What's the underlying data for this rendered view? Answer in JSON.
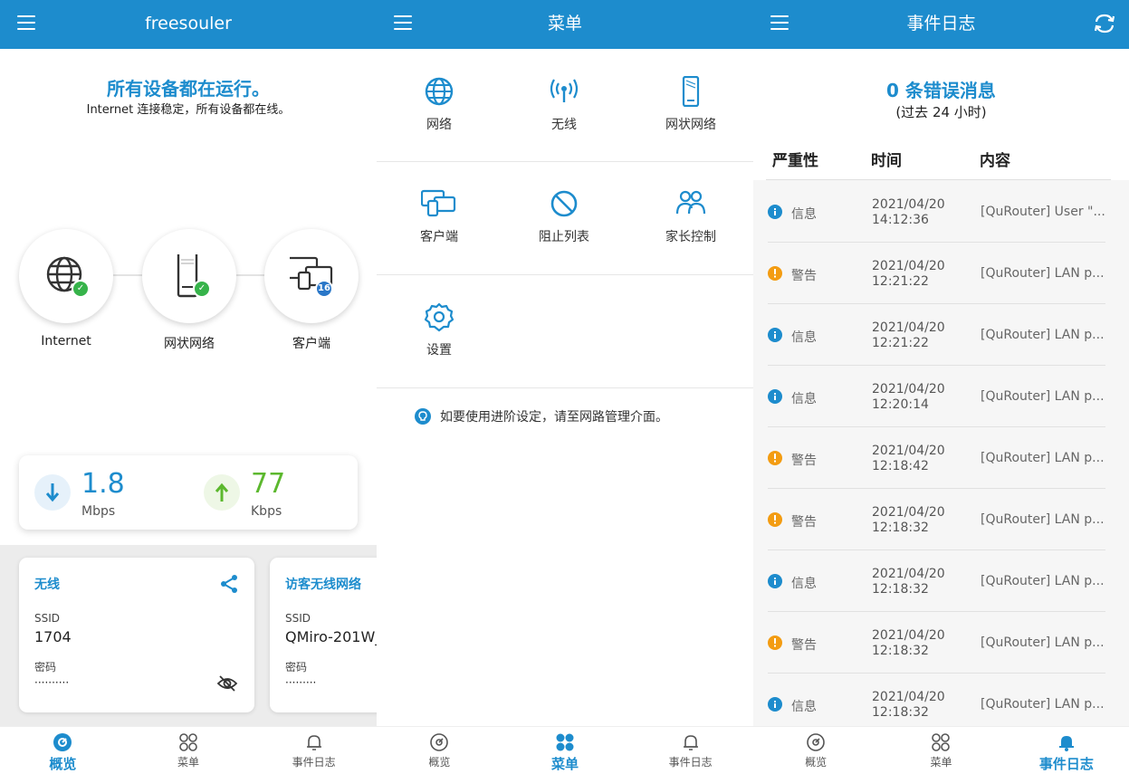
{
  "overview": {
    "app_title": "freesouler",
    "status_title": "所有设备都在运行。",
    "status_sub": "Internet 连接稳定，所有设备都在线。",
    "nodes": [
      {
        "label": "Internet",
        "icon": "globe-icon",
        "status": "ok"
      },
      {
        "label": "网状网络",
        "icon": "router-icon",
        "status": "ok"
      },
      {
        "label": "客户端",
        "icon": "clients-icon",
        "count": "16"
      }
    ],
    "download": {
      "value": "1.8",
      "unit": "Mbps"
    },
    "upload": {
      "value": "77",
      "unit": "Kbps"
    },
    "wireless_card": {
      "title": "无线",
      "ssid_label": "SSID",
      "ssid": "1704",
      "pwd_label": "密码",
      "pwd_mask": "··········"
    },
    "guest_card": {
      "title": "访客无线网络",
      "ssid_label": "SSID",
      "ssid": "QMiro-201W_",
      "pwd_label": "密码",
      "pwd_mask": "·········"
    }
  },
  "menu": {
    "title": "菜单",
    "items": [
      {
        "label": "网络",
        "icon": "globe-icon"
      },
      {
        "label": "无线",
        "icon": "wireless-icon"
      },
      {
        "label": "网状网络",
        "icon": "router-icon"
      },
      {
        "label": "客户端",
        "icon": "clients-icon"
      },
      {
        "label": "阻止列表",
        "icon": "block-icon"
      },
      {
        "label": "家长控制",
        "icon": "parental-icon"
      },
      {
        "label": "设置",
        "icon": "gear-icon"
      }
    ],
    "tip": "如要使用进阶设定，请至网路管理介面。"
  },
  "eventlog": {
    "title": "事件日志",
    "error_count": "0 条错误消息",
    "error_period": "(过去 24 小时)",
    "columns": [
      "严重性",
      "时间",
      "内容"
    ],
    "rows": [
      {
        "severity": "信息",
        "level": "info",
        "date": "2021/04/20",
        "time": "14:12:36",
        "content": "[QuRouter] User \"..."
      },
      {
        "severity": "警告",
        "level": "warn",
        "date": "2021/04/20",
        "time": "12:21:22",
        "content": "[QuRouter] LAN p..."
      },
      {
        "severity": "信息",
        "level": "info",
        "date": "2021/04/20",
        "time": "12:21:22",
        "content": "[QuRouter] LAN p..."
      },
      {
        "severity": "信息",
        "level": "info",
        "date": "2021/04/20",
        "time": "12:20:14",
        "content": "[QuRouter] LAN p..."
      },
      {
        "severity": "警告",
        "level": "warn",
        "date": "2021/04/20",
        "time": "12:18:42",
        "content": "[QuRouter] LAN p..."
      },
      {
        "severity": "警告",
        "level": "warn",
        "date": "2021/04/20",
        "time": "12:18:32",
        "content": "[QuRouter] LAN p..."
      },
      {
        "severity": "信息",
        "level": "info",
        "date": "2021/04/20",
        "time": "12:18:32",
        "content": "[QuRouter] LAN p..."
      },
      {
        "severity": "警告",
        "level": "warn",
        "date": "2021/04/20",
        "time": "12:18:32",
        "content": "[QuRouter] LAN p..."
      },
      {
        "severity": "信息",
        "level": "info",
        "date": "2021/04/20",
        "time": "12:18:32",
        "content": "[QuRouter] LAN p..."
      }
    ]
  },
  "bottom_nav": [
    "概览",
    "菜单",
    "事件日志"
  ],
  "colors": {
    "accent": "#1d8ccd",
    "ok": "#36b34a",
    "warn": "#f39c12",
    "upload": "#5cb82e",
    "download": "#1d8ccd"
  }
}
